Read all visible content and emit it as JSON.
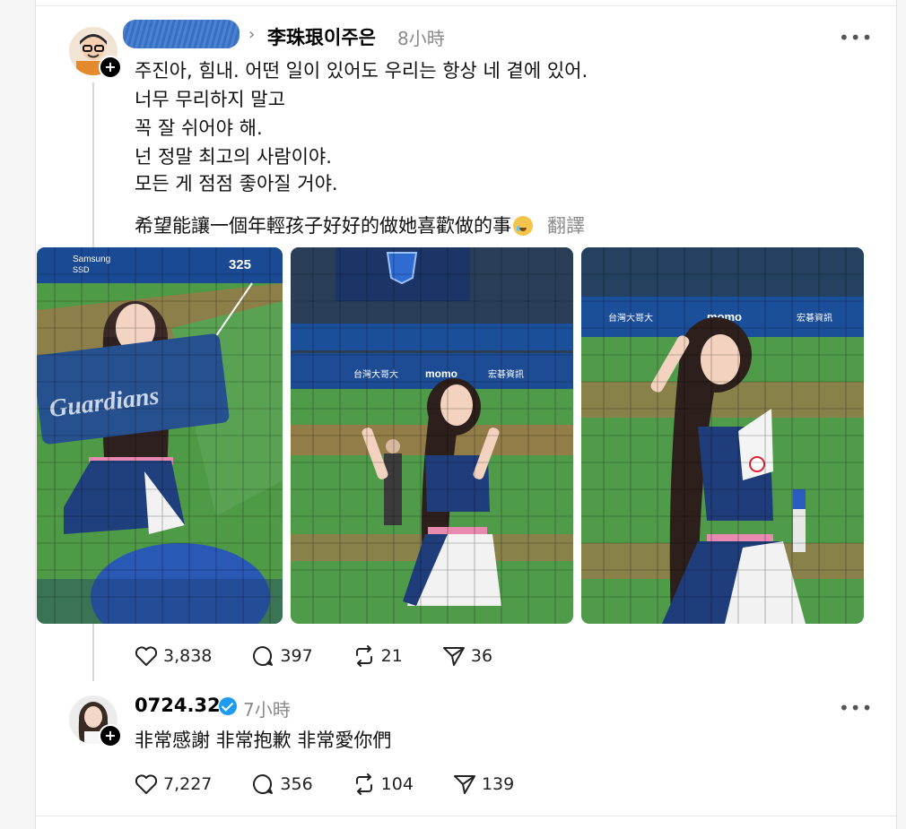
{
  "post1": {
    "author": "李珠珢이주은",
    "time": "8小時",
    "lines": [
      "주진아, 힘내. 어떤 일이 있어도 우리는 항상 네 곁에 있어.",
      "너무 무리하지 말고",
      "꼭 잘 쉬어야 해.",
      "넌 정말 최고의 사람이야.",
      "모든 게 점점 좋아질 거야."
    ],
    "chinese": "希望能讓一個年輕孩子好好的做她喜歡做的事",
    "translate": "翻譯",
    "photos": [
      {
        "scoreboard_brand": "Samsung",
        "scoreboard_sub": "SSD",
        "scoreboard_num": "325",
        "towel_text": "Guardians"
      },
      {
        "ad1": "台灣大哥大",
        "ad2": "momo",
        "ad3": "宏碁資訊"
      },
      {
        "ad1": "台灣大哥大",
        "ad2": "momo",
        "ad3": "宏碁資訊"
      }
    ],
    "stats": {
      "likes": "3,838",
      "replies": "397",
      "reposts": "21",
      "shares": "36"
    }
  },
  "post2": {
    "author": "0724.32",
    "time": "7小時",
    "text": "非常感謝 非常抱歉 非常愛你們",
    "stats": {
      "likes": "7,227",
      "replies": "356",
      "reposts": "104",
      "shares": "139"
    }
  },
  "more_label": "•••",
  "colors": {
    "verified": "#1d9bf0",
    "field_green": "#4f9b4a",
    "stadium_blue": "#1c4f9a"
  }
}
